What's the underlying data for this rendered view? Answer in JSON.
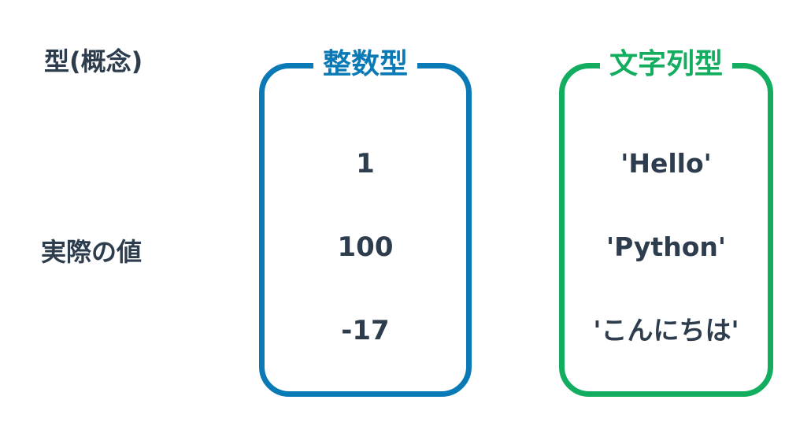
{
  "labels": {
    "type_concept": "型(概念)",
    "actual_value": "実際の値"
  },
  "integer_box": {
    "title": "整数型",
    "color": "#0a7ab6",
    "values": [
      "1",
      "100",
      "-17"
    ]
  },
  "string_box": {
    "title": "文字列型",
    "color": "#12ad5f",
    "values": [
      "'Hello'",
      "'Python'",
      "'こんにちは'"
    ]
  },
  "text_color": "#2e3d4e"
}
